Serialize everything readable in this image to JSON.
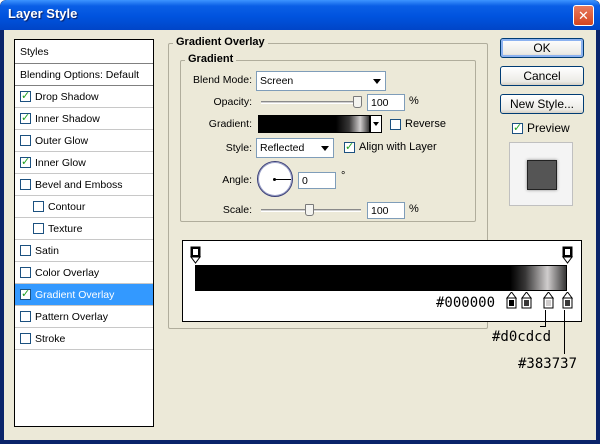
{
  "window": {
    "title": "Layer Style",
    "close_glyph": "✕"
  },
  "styles_list": {
    "header": "Styles",
    "blending": "Blending Options: Default",
    "items": [
      {
        "label": "Drop Shadow",
        "checked": true,
        "indent": false,
        "selected": false
      },
      {
        "label": "Inner Shadow",
        "checked": true,
        "indent": false,
        "selected": false
      },
      {
        "label": "Outer Glow",
        "checked": false,
        "indent": false,
        "selected": false
      },
      {
        "label": "Inner Glow",
        "checked": true,
        "indent": false,
        "selected": false
      },
      {
        "label": "Bevel and Emboss",
        "checked": false,
        "indent": false,
        "selected": false
      },
      {
        "label": "Contour",
        "checked": false,
        "indent": true,
        "selected": false
      },
      {
        "label": "Texture",
        "checked": false,
        "indent": true,
        "selected": false
      },
      {
        "label": "Satin",
        "checked": false,
        "indent": false,
        "selected": false
      },
      {
        "label": "Color Overlay",
        "checked": false,
        "indent": false,
        "selected": false
      },
      {
        "label": "Gradient Overlay",
        "checked": true,
        "indent": false,
        "selected": true
      },
      {
        "label": "Pattern Overlay",
        "checked": false,
        "indent": false,
        "selected": false
      },
      {
        "label": "Stroke",
        "checked": false,
        "indent": false,
        "selected": false
      }
    ]
  },
  "gradient_overlay": {
    "group_title": "Gradient Overlay",
    "subgroup_title": "Gradient",
    "blend_mode_label": "Blend Mode:",
    "blend_mode_value": "Screen",
    "opacity_label": "Opacity:",
    "opacity_value": "100",
    "opacity_unit": "%",
    "opacity_level": 1.0,
    "gradient_label": "Gradient:",
    "reverse_label": "Reverse",
    "reverse_checked": false,
    "style_label": "Style:",
    "style_value": "Reflected",
    "align_label": "Align with Layer",
    "align_checked": true,
    "angle_label": "Angle:",
    "angle_value": "0",
    "angle_unit": "°",
    "scale_label": "Scale:",
    "scale_value": "100",
    "scale_unit": "%",
    "scale_level": 0.5
  },
  "buttons": {
    "ok": "OK",
    "cancel": "Cancel",
    "new_style": "New Style...",
    "preview_label": "Preview",
    "preview_checked": true
  },
  "gradient_editor": {
    "stops": [
      {
        "color": "#000000",
        "position": 0.0
      },
      {
        "color": "#000000",
        "position": 0.85
      },
      {
        "color": "#383737",
        "position": 0.89
      },
      {
        "color": "#d0cdcd",
        "position": 0.95
      },
      {
        "color": "#383737",
        "position": 1.0
      }
    ],
    "annotations": {
      "black": "#000000",
      "light": "#d0cdcd",
      "dark": "#383737"
    }
  }
}
